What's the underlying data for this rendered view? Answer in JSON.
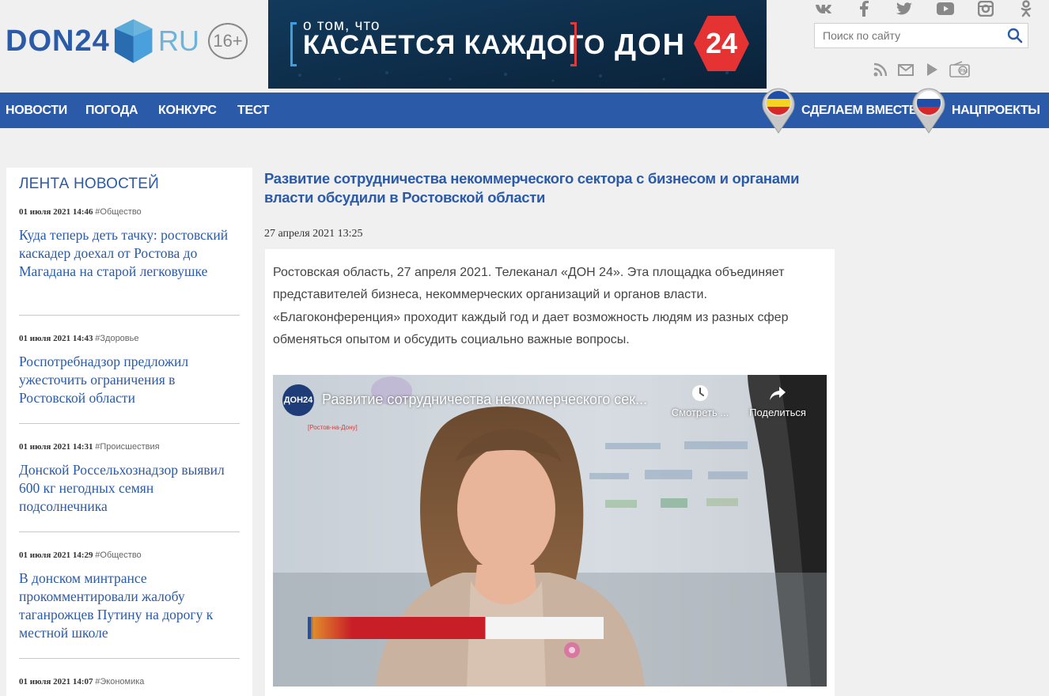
{
  "header": {
    "logo_main": "DON24",
    "logo_suffix": "RU",
    "age_rating": "16+",
    "banner": {
      "small_text": "о том, что",
      "big_text": "КАСАЕТСЯ КАЖДОГО",
      "brand": "ДОН",
      "brand_num": "24"
    },
    "socials": [
      {
        "icon": "vk-icon",
        "glyph": "vk"
      },
      {
        "icon": "facebook-icon",
        "glyph": "f"
      },
      {
        "icon": "twitter-icon",
        "glyph": "🐦"
      },
      {
        "icon": "youtube-icon",
        "glyph": "▶"
      },
      {
        "icon": "instagram-icon",
        "glyph": "◎"
      },
      {
        "icon": "odnoklassniki-icon",
        "glyph": "ок"
      }
    ],
    "search_placeholder": "Поиск по сайту"
  },
  "nav": {
    "items": [
      "НОВОСТИ",
      "ПОГОДА",
      "КОНКУРС",
      "ТЕСТ"
    ],
    "right_items": [
      "СДЕЛАЕМ ВМЕСТЕ",
      "НАЦПРОЕКТЫ"
    ]
  },
  "sidebar": {
    "title": "ЛЕНТА НОВОСТЕЙ",
    "news": [
      {
        "date": "01 июля 2021 14:46",
        "tag": "#Общество",
        "title": "Куда теперь деть тачку: ростовский каскадер доехал от Ростова до Магадана на старой легковушке"
      },
      {
        "date": "01 июля 2021 14:43",
        "tag": "#Здоровье",
        "title": "Роспотребнадзор предложил ужесточить ограничения в Ростовской области"
      },
      {
        "date": "01 июля 2021 14:31",
        "tag": "#Происшествия",
        "title": "Донской Россельхознадзор выявил 600 кг негодных семян подсолнечника"
      },
      {
        "date": "01 июля 2021 14:29",
        "tag": "#Общество",
        "title": "В донском минтрансе прокомментировали жалобу таганрожцев Путину на дорогу к местной школе"
      },
      {
        "date": "01 июля 2021 14:07",
        "tag": "#Экономика",
        "title": ""
      }
    ]
  },
  "article": {
    "title": "Развитие сотрудничества некоммерческого сектора с бизнесом и органами власти обсудили в Ростовской области",
    "date": "27 апреля 2021 13:25",
    "lead": "Ростовская область, 27 апреля 2021. Телеканал «ДОН 24». Эта площадка объединяет представителей бизнеса, некоммерческих организаций и органов власти. «Благоконференция» проходит каждый год и дает возможность людям из разных сфер обменяться опытом и обсудить социально важные вопросы.",
    "video": {
      "channel_logo": "ДОН24",
      "location_caption": "[Ростов-на-Дону]",
      "title": "Развитие сотрудничества некоммерческого сек...",
      "watch_later": "Смотреть ...",
      "share": "Поделиться"
    }
  },
  "colors": {
    "brand_blue": "#2a5aa8",
    "nav_blue": "#2a5aa8",
    "banner_red": "#e53232",
    "page_bg": "#f0f0f0"
  }
}
